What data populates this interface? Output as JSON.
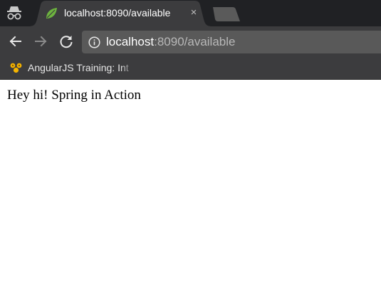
{
  "colors": {
    "frame": "#202124",
    "toolbar": "#3c3c3e",
    "tab_active": "#3c3c3e",
    "tab_inactive": "#5a5a5a",
    "omnibox": "#595959",
    "url_host": "#ffffff",
    "url_path": "#b8b8b8",
    "favicon_leaf": "#6db33f"
  },
  "tabstrip": {
    "incognito_icon": "incognito-icon",
    "active_tab": {
      "title": "localhost:8090/available",
      "favicon": "spring-leaf-icon",
      "close_label": "×"
    },
    "new_tab_icon": "new-tab-icon"
  },
  "toolbar": {
    "back_icon": "back-arrow-icon",
    "forward_icon": "forward-arrow-icon",
    "reload_icon": "reload-icon",
    "omnibox": {
      "info_icon": "info-icon",
      "url_host": "localhost",
      "url_rest": ":8090/available"
    }
  },
  "bookmarks_bar": {
    "items": [
      {
        "label": "AngularJS Training: Int",
        "icon": "angularjs-bookmark-icon"
      }
    ]
  },
  "page": {
    "body_text": "Hey hi! Spring in Action"
  }
}
